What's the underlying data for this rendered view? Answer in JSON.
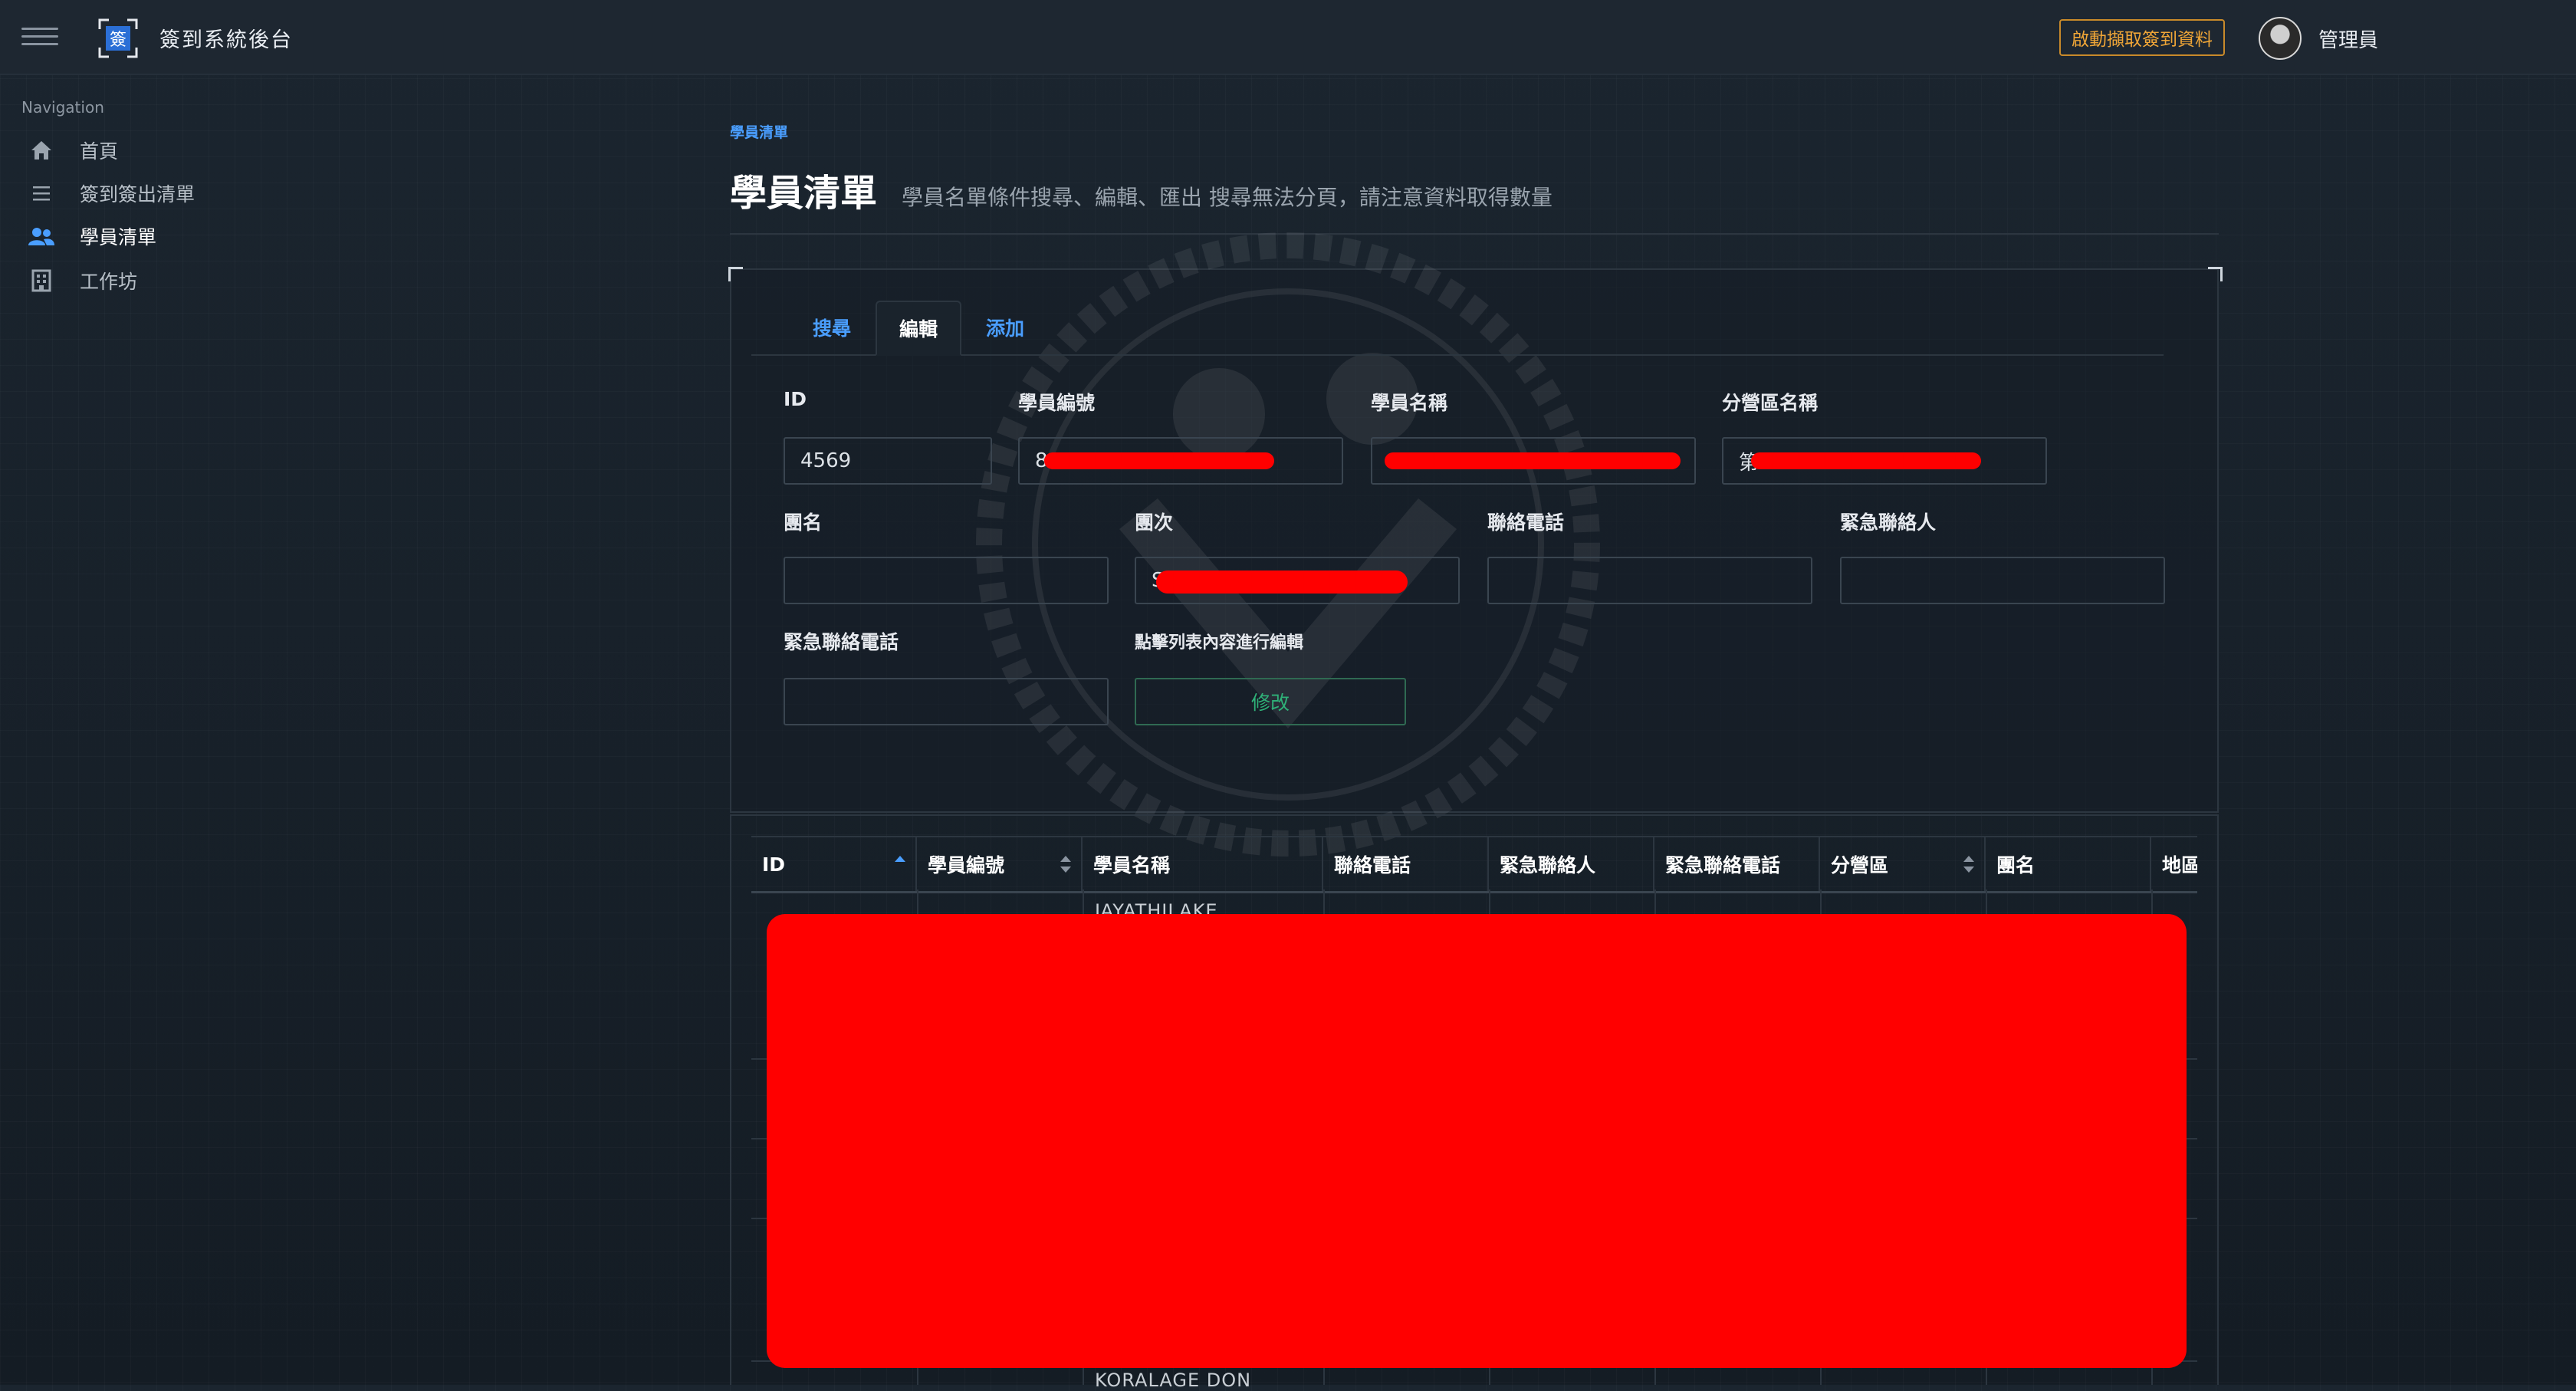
{
  "app": {
    "title": "簽到系統後台",
    "logo_char": "簽"
  },
  "topbar": {
    "action_label": "啟動擷取簽到資料",
    "user_name": "管理員"
  },
  "sidebar": {
    "heading": "Navigation",
    "items": [
      {
        "label": "首頁",
        "icon": "home-icon",
        "active": false
      },
      {
        "label": "簽到簽出清單",
        "icon": "list-icon",
        "active": false
      },
      {
        "label": "學員清單",
        "icon": "users-icon",
        "active": true
      },
      {
        "label": "工作坊",
        "icon": "building-icon",
        "active": false
      }
    ]
  },
  "header": {
    "breadcrumb": "學員清單",
    "title": "學員清單",
    "subtitle": "學員名單條件搜尋、編輯、匯出 搜尋無法分頁，請注意資料取得數量"
  },
  "tabs": [
    {
      "label": "搜尋",
      "active": false
    },
    {
      "label": "編輯",
      "active": true
    },
    {
      "label": "添加",
      "active": false
    }
  ],
  "form": {
    "id": {
      "label": "ID",
      "value": "4569"
    },
    "student_no": {
      "label": "學員編號",
      "value": "8"
    },
    "student_name": {
      "label": "學員名稱",
      "value": ""
    },
    "branch_name": {
      "label": "分營區名稱",
      "value": "第"
    },
    "group_name": {
      "label": "團名",
      "value": ""
    },
    "group_no": {
      "label": "團次",
      "value": "S"
    },
    "phone": {
      "label": "聯絡電話",
      "value": ""
    },
    "emergency_contact": {
      "label": "緊急聯絡人",
      "value": ""
    },
    "emergency_phone": {
      "label": "緊急聯絡電話",
      "value": ""
    },
    "edit_hint": "點擊列表內容進行編輯",
    "modify_button": "修改"
  },
  "table": {
    "columns": [
      "ID",
      "學員編號",
      "學員名稱",
      "聯絡電話",
      "緊急聯絡人",
      "緊急聯絡電話",
      "分營區",
      "團名",
      "地區"
    ],
    "visible_text": [
      "JAYATHILAKE",
      "KORALAGE DON"
    ]
  },
  "colors": {
    "accent": "#4a9eff",
    "warning": "#f0a637",
    "success": "#2fb178",
    "redaction": "#ff0000"
  }
}
